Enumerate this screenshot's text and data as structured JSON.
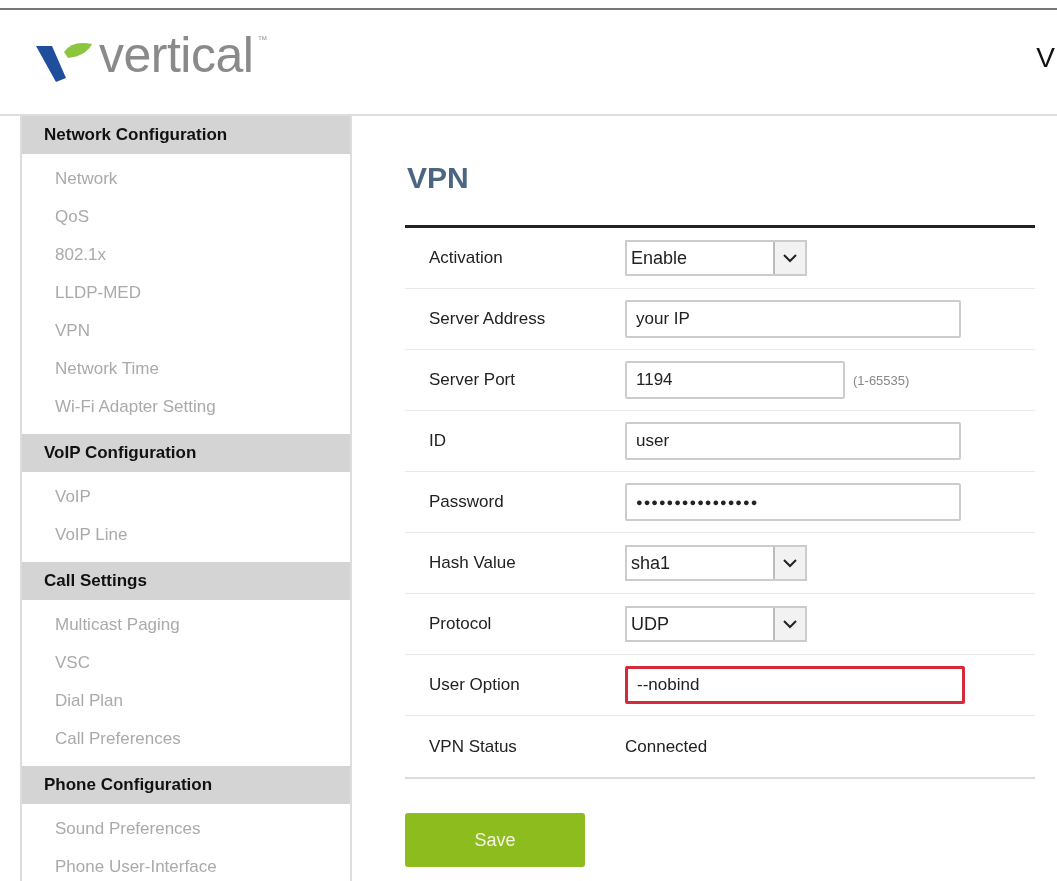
{
  "header": {
    "logo_text": "vertical",
    "logo_mark": "™",
    "title": "V"
  },
  "sidebar": {
    "sections": [
      {
        "heading": "Network Configuration",
        "items": [
          {
            "label": "Network"
          },
          {
            "label": "QoS"
          },
          {
            "label": "802.1x"
          },
          {
            "label": "LLDP-MED"
          },
          {
            "label": "VPN"
          },
          {
            "label": "Network Time"
          },
          {
            "label": "Wi-Fi Adapter Setting"
          }
        ]
      },
      {
        "heading": "VoIP Configuration",
        "items": [
          {
            "label": "VoIP"
          },
          {
            "label": "VoIP Line"
          }
        ]
      },
      {
        "heading": "Call Settings",
        "items": [
          {
            "label": "Multicast Paging"
          },
          {
            "label": "VSC"
          },
          {
            "label": "Dial Plan"
          },
          {
            "label": "Call Preferences"
          }
        ]
      },
      {
        "heading": "Phone Configuration",
        "items": [
          {
            "label": "Sound Preferences"
          },
          {
            "label": "Phone User-Interface"
          }
        ]
      }
    ]
  },
  "page": {
    "title": "VPN",
    "fields": [
      {
        "kind": "select",
        "label": "Activation",
        "value": "Enable"
      },
      {
        "kind": "text",
        "label": "Server Address",
        "value": "your IP"
      },
      {
        "kind": "short",
        "label": "Server Port",
        "value": "1194",
        "hint": "(1-65535)"
      },
      {
        "kind": "text",
        "label": "ID",
        "value": "user"
      },
      {
        "kind": "password",
        "label": "Password",
        "value": "●●●●●●●●●●●●●●●●"
      },
      {
        "kind": "select",
        "label": "Hash Value",
        "value": "sha1"
      },
      {
        "kind": "select",
        "label": "Protocol",
        "value": "UDP"
      },
      {
        "kind": "text",
        "label": "User Option",
        "value": "--nobind",
        "highlighted": true
      },
      {
        "kind": "static",
        "label": "VPN Status",
        "value": "Connected"
      }
    ],
    "save_button": "Save"
  }
}
